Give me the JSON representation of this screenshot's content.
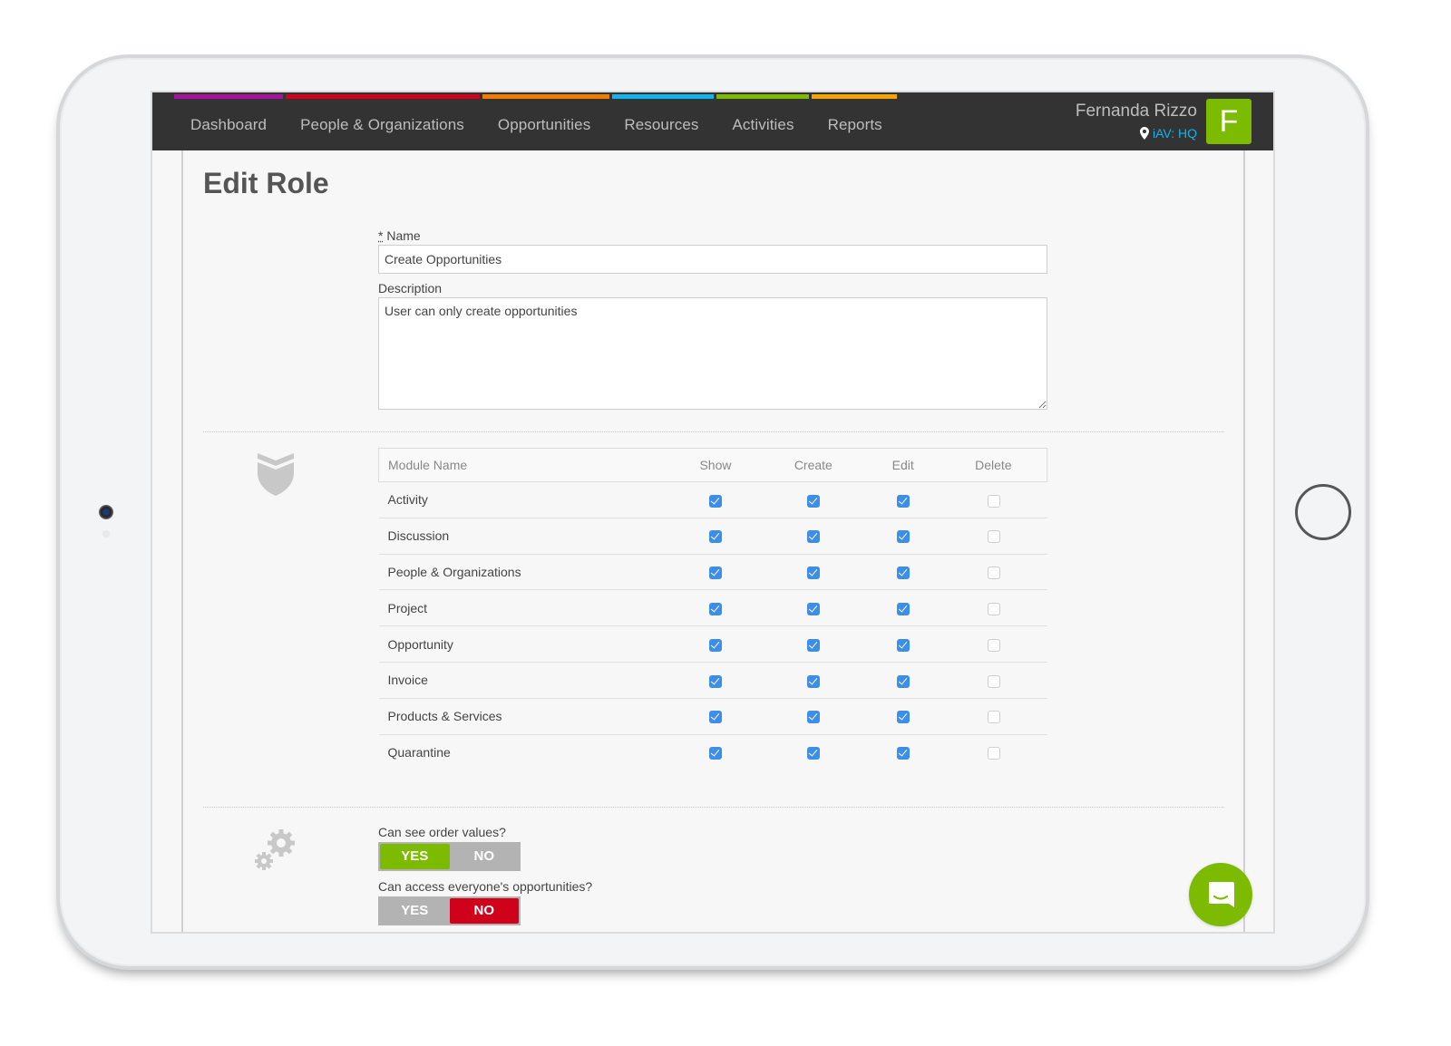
{
  "nav": {
    "items": [
      {
        "label": "Dashboard",
        "color": "#a6139e"
      },
      {
        "label": "People & Organizations",
        "color": "#d0021b"
      },
      {
        "label": "Opportunities",
        "color": "#f27c00"
      },
      {
        "label": "Resources",
        "color": "#12b3ec"
      },
      {
        "label": "Activities",
        "color": "#7cbb00"
      },
      {
        "label": "Reports",
        "color": "#f5a300"
      }
    ]
  },
  "user": {
    "name": "Fernanda Rizzo",
    "location": "iAV: HQ",
    "avatar_initial": "F",
    "avatar_color": "#7cbb00",
    "location_icon": "map-pin-icon"
  },
  "page": {
    "title": "Edit Role"
  },
  "form": {
    "name_required_marker": "*",
    "name_label": "Name",
    "name_value": "Create Opportunities",
    "description_label": "Description",
    "description_value": "User can only create opportunities"
  },
  "permissions": {
    "section_icon": "shield-icon",
    "columns": [
      "Module Name",
      "Show",
      "Create",
      "Edit",
      "Delete"
    ],
    "rows": [
      {
        "module": "Activity",
        "show": true,
        "create": true,
        "edit": true,
        "delete": false
      },
      {
        "module": "Discussion",
        "show": true,
        "create": true,
        "edit": true,
        "delete": false
      },
      {
        "module": "People & Organizations",
        "show": true,
        "create": true,
        "edit": true,
        "delete": false
      },
      {
        "module": "Project",
        "show": true,
        "create": true,
        "edit": true,
        "delete": false
      },
      {
        "module": "Opportunity",
        "show": true,
        "create": true,
        "edit": true,
        "delete": false
      },
      {
        "module": "Invoice",
        "show": true,
        "create": true,
        "edit": true,
        "delete": false
      },
      {
        "module": "Products & Services",
        "show": true,
        "create": true,
        "edit": true,
        "delete": false
      },
      {
        "module": "Quarantine",
        "show": true,
        "create": true,
        "edit": true,
        "delete": false
      }
    ]
  },
  "settings": {
    "section_icon": "gears-icon",
    "questions": [
      {
        "label": "Can see order values?",
        "yes_label": "YES",
        "no_label": "NO",
        "value": "yes"
      },
      {
        "label": "Can access everyone's opportunities?",
        "yes_label": "YES",
        "no_label": "NO",
        "value": "no"
      }
    ]
  },
  "chat": {
    "icon": "chat-icon",
    "color": "#7cbb00"
  }
}
